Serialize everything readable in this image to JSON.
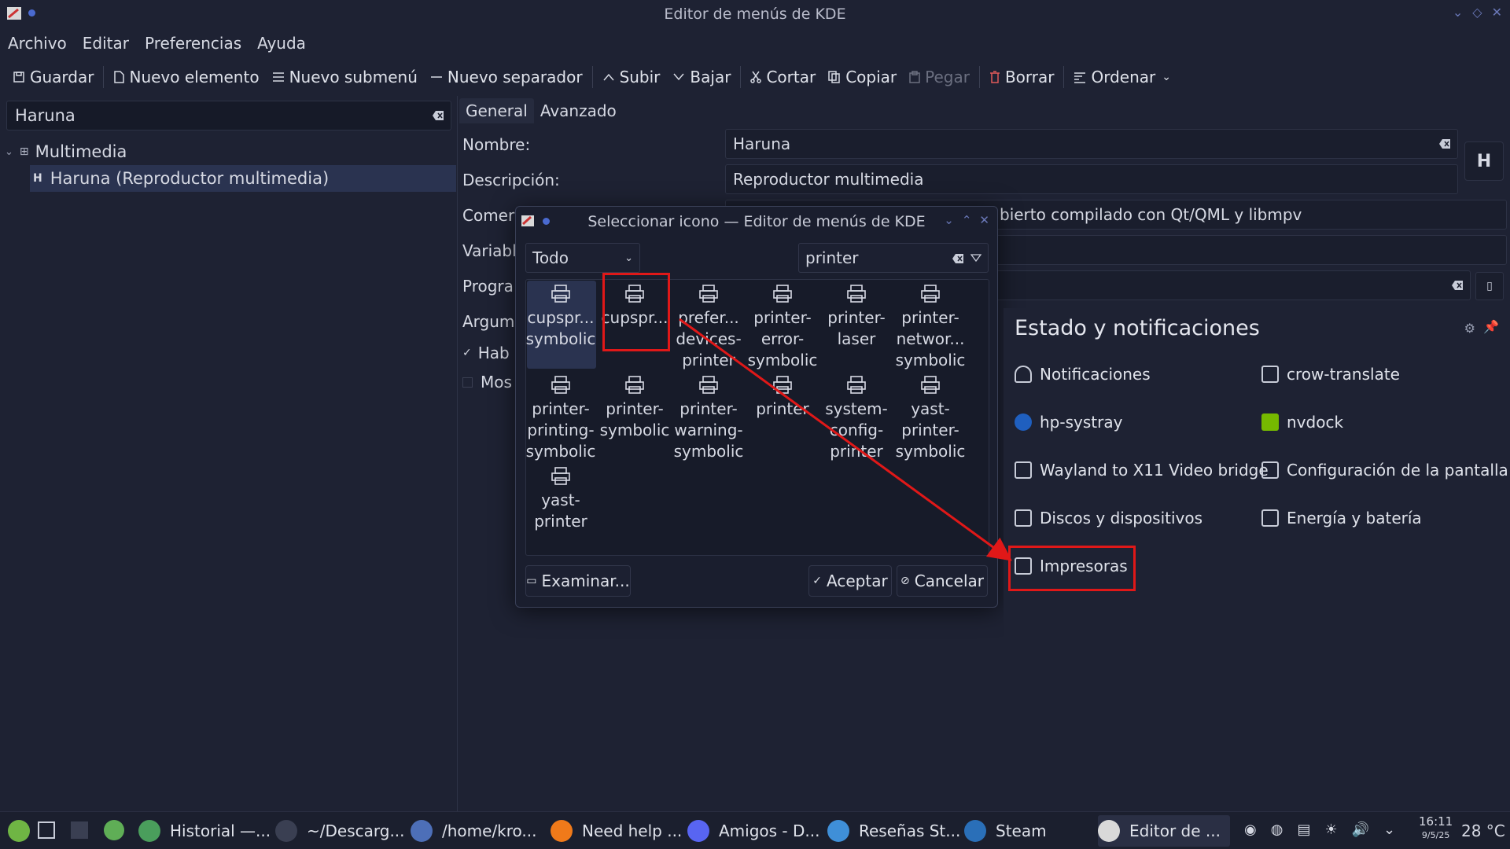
{
  "window": {
    "title": "Editor de menús de KDE"
  },
  "menubar": [
    "Archivo",
    "Editar",
    "Preferencias",
    "Ayuda"
  ],
  "toolbar": {
    "save": "Guardar",
    "new_item": "Nuevo elemento",
    "new_submenu": "Nuevo submenú",
    "new_separator": "Nuevo separador",
    "up": "Subir",
    "down": "Bajar",
    "cut": "Cortar",
    "copy": "Copiar",
    "paste": "Pegar",
    "delete": "Borrar",
    "sort": "Ordenar"
  },
  "left": {
    "search_value": "Haruna",
    "tree": [
      {
        "label": "Multimedia"
      },
      {
        "label": "Haruna (Reproductor multimedia)"
      }
    ]
  },
  "tabs": [
    "General",
    "Avanzado"
  ],
  "form": {
    "name_label": "Nombre:",
    "name_value": "Haruna",
    "desc_label": "Descripción:",
    "desc_value": "Reproductor multimedia",
    "comment_label": "Comer",
    "comment_value": "bierto compilado con Qt/QML y libmpv",
    "env_label": "Variabl",
    "prog_label": "Progra",
    "args_label": "Argum",
    "enable_label": "Hab",
    "show_label": "Mos",
    "app_icon_letter": "H"
  },
  "dialog": {
    "title": "Seleccionar icono — Editor de menús de KDE",
    "filter_select": "Todo",
    "search_value": "printer",
    "icons": [
      {
        "label": "cupspr...\nsymbolic"
      },
      {
        "label": "cupspr..."
      },
      {
        "label": "prefer...\ndevices-\nprinter"
      },
      {
        "label": "printer-\nerror-\nsymbolic"
      },
      {
        "label": "printer-\nlaser"
      },
      {
        "label": "printer-\nnetwor...\nsymbolic"
      },
      {
        "label": "printer-\nprinting-\nsymbolic"
      },
      {
        "label": "printer-\nsymbolic"
      },
      {
        "label": "printer-\nwarning-\nsymbolic"
      },
      {
        "label": "printer"
      },
      {
        "label": "system-\nconfig-\nprinter"
      },
      {
        "label": "yast-\nprinter-\nsymbolic"
      },
      {
        "label": "yast-\nprinter"
      }
    ],
    "browse": "Examinar...",
    "accept": "Aceptar",
    "cancel": "Cancelar"
  },
  "notifications": {
    "title": "Estado y notificaciones",
    "items": [
      {
        "label": "Notificaciones",
        "icon": "bell-icon"
      },
      {
        "label": "crow-translate",
        "icon": "translate-icon"
      },
      {
        "label": "hp-systray",
        "icon": "hp-icon"
      },
      {
        "label": "nvdock",
        "icon": "nvidia-icon"
      },
      {
        "label": "Wayland to X11 Video bridge",
        "icon": "monitor-icon"
      },
      {
        "label": "Configuración de la pantalla",
        "icon": "display-icon"
      },
      {
        "label": "Discos y dispositivos",
        "icon": "disk-icon"
      },
      {
        "label": "Energía y batería",
        "icon": "battery-icon"
      },
      {
        "label": "Impresoras",
        "icon": "printer-icon"
      }
    ]
  },
  "taskbar": {
    "tasks": [
      {
        "label": "Historial —..."
      },
      {
        "label": "~/Descarg..."
      },
      {
        "label": "/home/kro..."
      },
      {
        "label": "Need help ..."
      },
      {
        "label": "Amigos - D..."
      },
      {
        "label": "Reseñas St..."
      },
      {
        "label": "Steam"
      },
      {
        "label": "Editor de ..."
      }
    ],
    "clock_time": "16:11",
    "clock_date": "9/5/25",
    "temperature": "28 °C"
  },
  "colors": {
    "highlight": "#e01818",
    "selection": "#2a3350"
  }
}
